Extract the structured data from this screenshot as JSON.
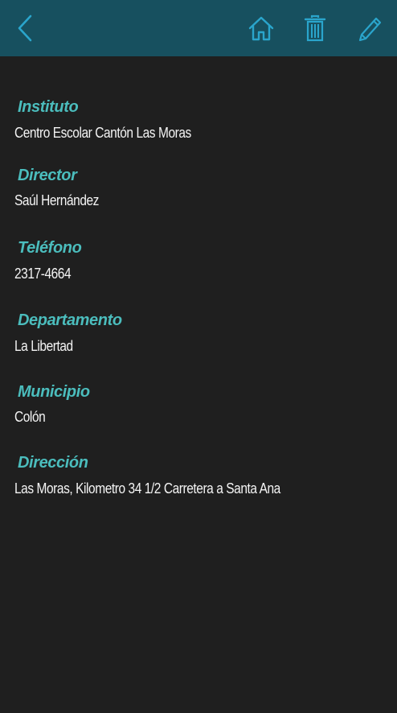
{
  "toolbar": {
    "icons": {
      "back": "chevron-left-icon",
      "home": "home-icon",
      "delete": "trash-icon",
      "edit": "pencil-icon"
    },
    "background": "#17505f",
    "icon_color": "#2aa5cc"
  },
  "fields": {
    "instituto": {
      "label": "Instituto",
      "value": "Centro Escolar Cantón Las Moras"
    },
    "director": {
      "label": "Director",
      "value": "Saúl Hernández"
    },
    "telefono": {
      "label": "Teléfono",
      "value": "2317-4664"
    },
    "departamento": {
      "label": "Departamento",
      "value": "La Libertad"
    },
    "municipio": {
      "label": "Municipio",
      "value": "Colón"
    },
    "direccion": {
      "label": "Dirección",
      "value": "Las Moras, Kilometro 34 1/2 Carretera a Santa Ana"
    }
  },
  "colors": {
    "label": "#4bbdbd",
    "value": "#f4f4f4",
    "background": "#1f1f1f"
  }
}
